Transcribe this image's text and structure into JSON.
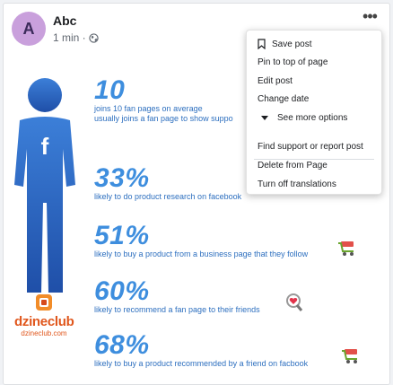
{
  "post": {
    "author": "Abc",
    "avatar_letter": "A",
    "time": "1 min ·",
    "privacy_icon": "globe-icon",
    "more_icon": "more-options-icon",
    "more_label": "•••"
  },
  "infographic": {
    "brand_name": "dzineclub",
    "brand_url": "dzineclub.com",
    "stats": [
      {
        "value": "10",
        "lines": [
          "joins 10 fan pages on average",
          "usually joins a fan page to show suppo"
        ]
      },
      {
        "value": "33%",
        "lines": [
          "likely to do product research on facebook"
        ]
      },
      {
        "value": "51%",
        "lines": [
          "likely to buy a product from a business page that they follow"
        ]
      },
      {
        "value": "60%",
        "lines": [
          "likely to recommend a fan page to their friends"
        ]
      },
      {
        "value": "68%",
        "lines": [
          "likely to buy a product recommended by a friend on facbook"
        ]
      }
    ]
  },
  "menu": {
    "items": [
      {
        "label": "Save post",
        "icon": "bookmark-icon"
      },
      {
        "label": "Pin to top of page"
      },
      {
        "label": "Edit post"
      },
      {
        "label": "Change date"
      },
      {
        "label": "See more options",
        "icon": "caret-down-icon"
      },
      {
        "label": "Find support or report post"
      },
      {
        "label": "Delete from Page"
      },
      {
        "label": "Turn off translations"
      }
    ]
  },
  "colors": {
    "stat_blue": "#3e8ede",
    "text_blue": "#2d6fbf",
    "brand_orange": "#e0571d",
    "avatar_bg": "#c9a0dc"
  }
}
